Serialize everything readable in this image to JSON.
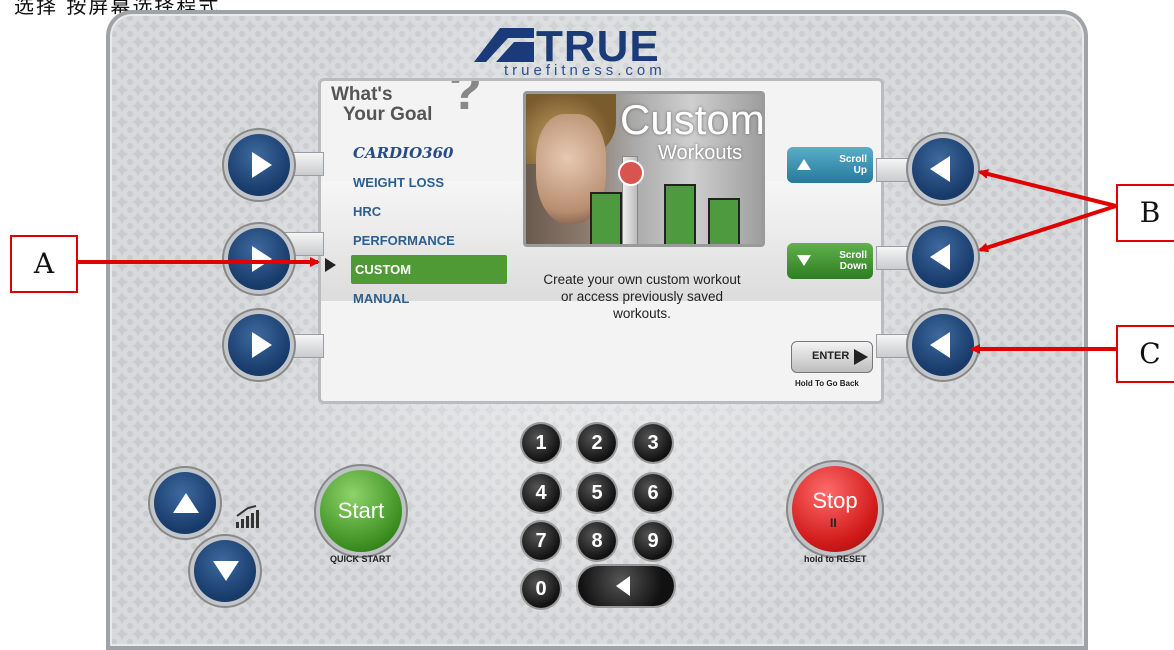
{
  "caption": "选择   按屏幕选择程式",
  "brand": {
    "name": "TRUE",
    "url": "truefitness.com"
  },
  "screen": {
    "heading_line1": "What's",
    "heading_line2": "Your Goal",
    "heading_mark": "?",
    "menu": [
      "CARDIO360",
      "WEIGHT LOSS",
      "HRC",
      "PERFORMANCE",
      "CUSTOM",
      "MANUAL"
    ],
    "selected": "CUSTOM",
    "photo_title": "Custom",
    "photo_subtitle": "Workouts",
    "description": "Create your own custom workout or access previously saved workouts.",
    "scroll_up_label": "Scroll Up",
    "scroll_down_label": "Scroll Down",
    "enter_label": "ENTER",
    "hold_label": "Hold To Go Back"
  },
  "controls": {
    "start_label": "Start",
    "quick_start_label": "QUICK START",
    "stop_label": "Stop",
    "stop_pause": "II",
    "reset_label": "hold to RESET",
    "keypad": [
      "1",
      "2",
      "3",
      "4",
      "5",
      "6",
      "7",
      "8",
      "9",
      "0"
    ]
  },
  "annotations": {
    "a": "A",
    "b": "B",
    "c": "C"
  },
  "colors": {
    "accent_green": "#4f9a35",
    "brand_blue": "#1b3a78",
    "annotation_red": "#e00000",
    "stop_red": "#d11a1a"
  }
}
